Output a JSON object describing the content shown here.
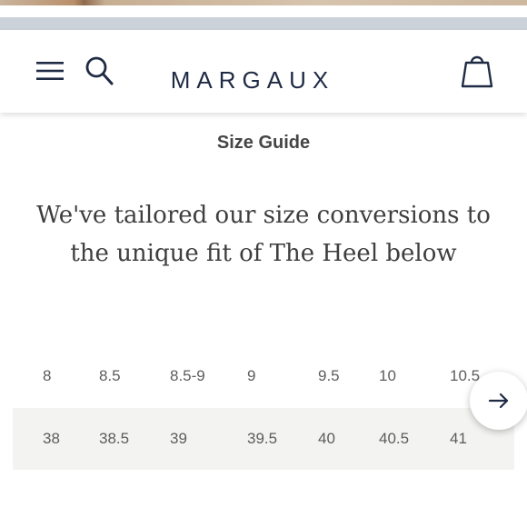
{
  "header": {
    "brand": "MARGAUX"
  },
  "page": {
    "title": "Size Guide",
    "intro": "We've tailored our size conversions to the unique fit of The Heel below"
  },
  "size_table": {
    "rows": [
      [
        "8",
        "8.5",
        "8.5-9",
        "9",
        "9.5",
        "10",
        "10.5"
      ],
      [
        "38",
        "38.5",
        "39",
        "39.5",
        "40",
        "40.5",
        "41"
      ]
    ]
  },
  "icons": {
    "menu": "hamburger-icon",
    "search": "search-icon",
    "bag": "shopping-bag-icon",
    "next": "arrow-right-icon"
  },
  "colors": {
    "brand": "#1f2a44",
    "table_alt_row": "#f3f3f1",
    "text": "#5d5d5d"
  }
}
